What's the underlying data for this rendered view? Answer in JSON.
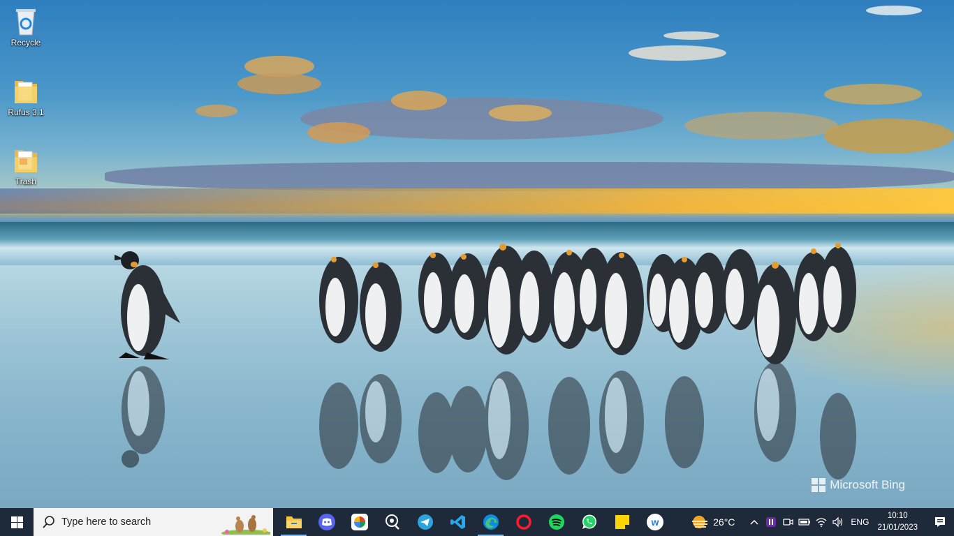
{
  "desktop": {
    "icons": [
      {
        "label": "Recycle",
        "icon": "recycle-bin-icon"
      },
      {
        "label": "Rufus 3.1",
        "icon": "folder-icon"
      },
      {
        "label": "Trash",
        "icon": "pdf-folder-icon"
      }
    ],
    "watermark": "Microsoft Bing"
  },
  "taskbar": {
    "search_placeholder": "Type here to search",
    "apps": [
      {
        "name": "File Explorer",
        "icon": "file-explorer-icon",
        "open": true
      },
      {
        "name": "Discord",
        "icon": "discord-icon",
        "open": false
      },
      {
        "name": "Picasa",
        "icon": "picasa-icon",
        "open": false
      },
      {
        "name": "Search tool",
        "icon": "magnifier-app-icon",
        "open": false
      },
      {
        "name": "Telegram",
        "icon": "telegram-icon",
        "open": false
      },
      {
        "name": "Visual Studio Code",
        "icon": "vscode-icon",
        "open": false
      },
      {
        "name": "Microsoft Edge",
        "icon": "edge-icon",
        "open": true
      },
      {
        "name": "Opera",
        "icon": "opera-icon",
        "open": false
      },
      {
        "name": "Spotify",
        "icon": "spotify-icon",
        "open": false
      },
      {
        "name": "WhatsApp",
        "icon": "whatsapp-icon",
        "open": false
      },
      {
        "name": "Sticky Notes",
        "icon": "sticky-notes-icon",
        "open": false
      },
      {
        "name": "W app",
        "icon": "w-app-icon",
        "open": false
      }
    ],
    "weather": {
      "temp": "26°C",
      "icon": "sunny-haze-icon"
    },
    "language": "ENG",
    "time": "10:10",
    "date": "21/01/2023"
  },
  "colors": {
    "taskbar_bg": "#1e2a3a",
    "search_bg": "#f3f3f3",
    "open_indicator": "#7fb8e8"
  }
}
